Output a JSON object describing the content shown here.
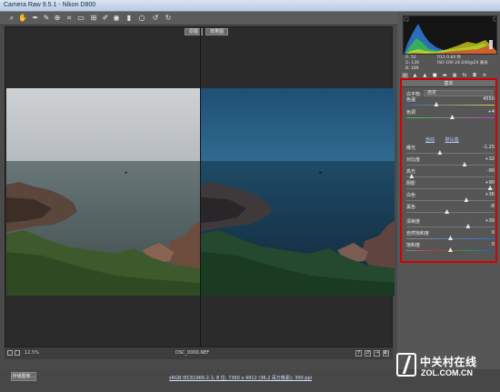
{
  "window": {
    "title": "Camera Raw 9.5.1 - Nikon D800"
  },
  "toolbar": {
    "tools": [
      "zoom-icon",
      "hand-icon",
      "white-balance-icon",
      "color-sampler-icon",
      "target-adjust-icon",
      "crop-icon",
      "straighten-icon",
      "transform-icon",
      "spot-removal-icon",
      "red-eye-icon",
      "adjustment-brush-icon",
      "graduated-filter-icon",
      "radial-filter-icon",
      "rotate-ccw-icon",
      "rotate-cw-icon"
    ]
  },
  "view": {
    "before_label": "原图",
    "after_label": "效果图"
  },
  "bottombar": {
    "zoom": "12.5%",
    "file_name": "DSC_0000.NEF"
  },
  "status": {
    "save_label": "存储图像...",
    "workflow": "sRGB IEC61966-2.1; 8 位; 7360 x 4912 (36.2 百万像素); 300 ppi"
  },
  "readout": {
    "r": "R:  52",
    "g": "G:  130",
    "b": "B:  189"
  },
  "camera_info": {
    "line1": "f/11   0.60 秒",
    "line2": "ISO 100   24-240@24 毫米"
  },
  "basic": {
    "title": "基本",
    "wb_label": "白平衡:",
    "wb_value": "自定",
    "tone_auto": "自动",
    "tone_default": "默认值",
    "sliders": [
      {
        "label": "色温",
        "value": "4550",
        "pos": 0.34
      },
      {
        "label": "色调",
        "value": "+4",
        "pos": 0.52
      },
      {
        "label": "曝光",
        "value": "-1.25",
        "pos": 0.38
      },
      {
        "label": "对比度",
        "value": "+32",
        "pos": 0.66
      },
      {
        "label": "高光",
        "value": "-90",
        "pos": 0.06
      },
      {
        "label": "阴影",
        "value": "+90",
        "pos": 0.95
      },
      {
        "label": "白色",
        "value": "+36",
        "pos": 0.68
      },
      {
        "label": "黑色",
        "value": "-8",
        "pos": 0.46
      },
      {
        "label": "清晰度",
        "value": "+39",
        "pos": 0.7
      },
      {
        "label": "自然饱和度",
        "value": "0",
        "pos": 0.5
      },
      {
        "label": "饱和度",
        "value": "0",
        "pos": 0.5
      }
    ]
  },
  "watermark": {
    "cn": "中关村在线",
    "en": "ZOL.COM.CN"
  }
}
